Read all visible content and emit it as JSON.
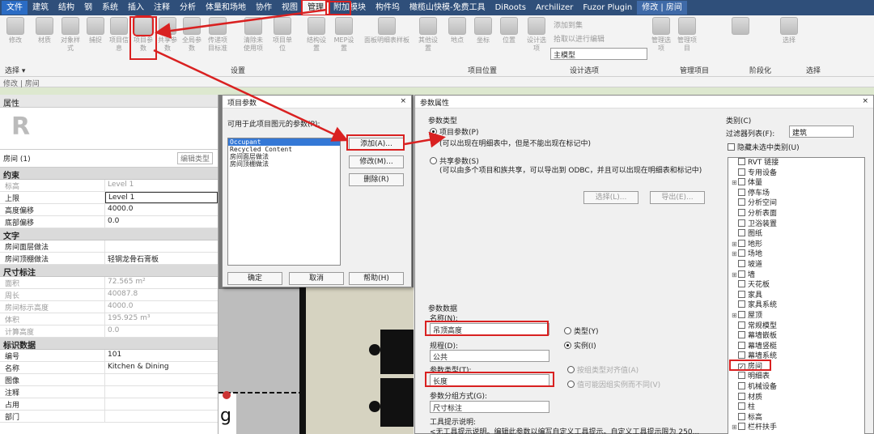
{
  "tabs": [
    "文件",
    "建筑",
    "结构",
    "钢",
    "系统",
    "插入",
    "注释",
    "分析",
    "体量和场地",
    "协作",
    "视图",
    "管理",
    "附加模块",
    "构件坞",
    "橄榄山快模-免费工具",
    "DiRoots",
    "Archilizer",
    "Fuzor Plugin",
    "修改 | 房间"
  ],
  "ribbon": {
    "buttons": [
      "修改",
      "材质",
      "对象样式",
      "捕捉",
      "项目信息",
      "项目参数",
      "共享参数",
      "全局参数",
      "传递项目标准",
      "清除未使用项",
      "项目单位",
      "结构设置",
      "MEP设置",
      "面板明细表样板",
      "其他设置",
      "地点",
      "坐标",
      "位置",
      "设计选项",
      "管理选项",
      "管理项目",
      "选择"
    ],
    "small": [
      "添加到集",
      "拾取以进行编辑"
    ],
    "main_model": "主模型",
    "groups": [
      "选择 ▾",
      "设置",
      "项目位置",
      "设计选项",
      "管理项目",
      "阶段化",
      "选择"
    ],
    "subrow": "修改 | 房间"
  },
  "properties": {
    "title": "属性",
    "type_selector": "房间 (1)",
    "edit_type": "编辑类型",
    "sections": [
      {
        "name": "约束",
        "rows": [
          [
            "标高",
            "Level 1",
            true
          ],
          [
            "上限",
            "Level 1",
            false
          ],
          [
            "高度偏移",
            "4000.0",
            false
          ],
          [
            "底部偏移",
            "0.0",
            false
          ]
        ]
      },
      {
        "name": "文字",
        "rows": [
          [
            "房间面层做法",
            "",
            false
          ],
          [
            "房间顶棚做法",
            "轻钢龙骨石膏板",
            false
          ]
        ]
      },
      {
        "name": "尺寸标注",
        "rows": [
          [
            "面积",
            "72.565 m²",
            true
          ],
          [
            "周长",
            "40087.8",
            true
          ],
          [
            "房间标示高度",
            "4000.0",
            true
          ],
          [
            "体积",
            "195.925 m³",
            true
          ],
          [
            "计算高度",
            "0.0",
            true
          ]
        ]
      },
      {
        "name": "标识数据",
        "rows": [
          [
            "编号",
            "101",
            false
          ],
          [
            "名称",
            "Kitchen & Dining",
            false
          ],
          [
            "图像",
            "",
            false
          ],
          [
            "注释",
            "",
            false
          ],
          [
            "占用",
            "",
            false
          ],
          [
            "部门",
            "",
            false
          ]
        ]
      }
    ]
  },
  "canvas": {
    "letter": "g"
  },
  "project_params": {
    "title": "项目参数",
    "close": "×",
    "label": "可用于此项目图元的参数(P):",
    "items": [
      "Occupant",
      "Recycled Content",
      "房间面层做法",
      "房间顶棚做法"
    ],
    "buttons": [
      "添加(A)...",
      "修改(M)...",
      "删除(R)"
    ],
    "bottom": [
      "确定",
      "取消",
      "帮助(H)"
    ]
  },
  "param_props": {
    "title": "参数属性",
    "close": "×",
    "type_heading": "参数类型",
    "project_param": "项目参数(P)",
    "project_desc": "(可以出现在明细表中，但是不能出现在标记中)",
    "shared_param": "共享参数(S)",
    "shared_desc": "(可以由多个项目和族共享，可以导出到 ODBC，并且可以出现在明细表和标记中)",
    "select_btn": "选择(L)...",
    "export_btn": "导出(E)...",
    "data_heading": "参数数据",
    "name_label": "名称(N):",
    "name_value": "吊顶高度",
    "type_radio": "类型(Y)",
    "instance_radio": "实例(I)",
    "discipline_label": "规程(D):",
    "discipline_value": "公共",
    "ptype_label": "参数类型(T):",
    "ptype_value": "长度",
    "group_label": "参数分组方式(G):",
    "group_value": "尺寸标注",
    "align_opt": "按组类型对齐值(A)",
    "vary_opt": "值可能因组实例而不同(V)",
    "tooltip_label": "工具提示说明:",
    "tooltip_value": "<无工具提示说明。编辑此参数以编写自定义工具提示。自定义工具提示限为 250...",
    "cat_heading": "类别(C)",
    "filter_label": "过滤器列表(F):",
    "filter_value": "建筑",
    "hide_unchecked": "隐藏未选中类别(U)",
    "categories": [
      [
        "RVT 链接",
        false,
        false
      ],
      [
        "专用设备",
        false,
        false
      ],
      [
        "体量",
        true,
        false
      ],
      [
        "停车场",
        false,
        false
      ],
      [
        "分析空间",
        false,
        false
      ],
      [
        "分析表面",
        false,
        false
      ],
      [
        "卫浴装置",
        false,
        false
      ],
      [
        "图纸",
        false,
        false
      ],
      [
        "地形",
        true,
        false
      ],
      [
        "场地",
        true,
        false
      ],
      [
        "坡道",
        false,
        false
      ],
      [
        "墙",
        true,
        false
      ],
      [
        "天花板",
        false,
        false
      ],
      [
        "家具",
        false,
        false
      ],
      [
        "家具系统",
        false,
        false
      ],
      [
        "屋顶",
        true,
        false
      ],
      [
        "常规模型",
        false,
        false
      ],
      [
        "幕墙嵌板",
        false,
        false
      ],
      [
        "幕墙竖梃",
        false,
        false
      ],
      [
        "幕墙系统",
        false,
        false
      ],
      [
        "房间",
        false,
        true
      ],
      [
        "明细表",
        false,
        false
      ],
      [
        "机械设备",
        false,
        false
      ],
      [
        "材质",
        false,
        false
      ],
      [
        "柱",
        false,
        false
      ],
      [
        "标高",
        false,
        false
      ],
      [
        "栏杆扶手",
        true,
        false
      ]
    ]
  }
}
